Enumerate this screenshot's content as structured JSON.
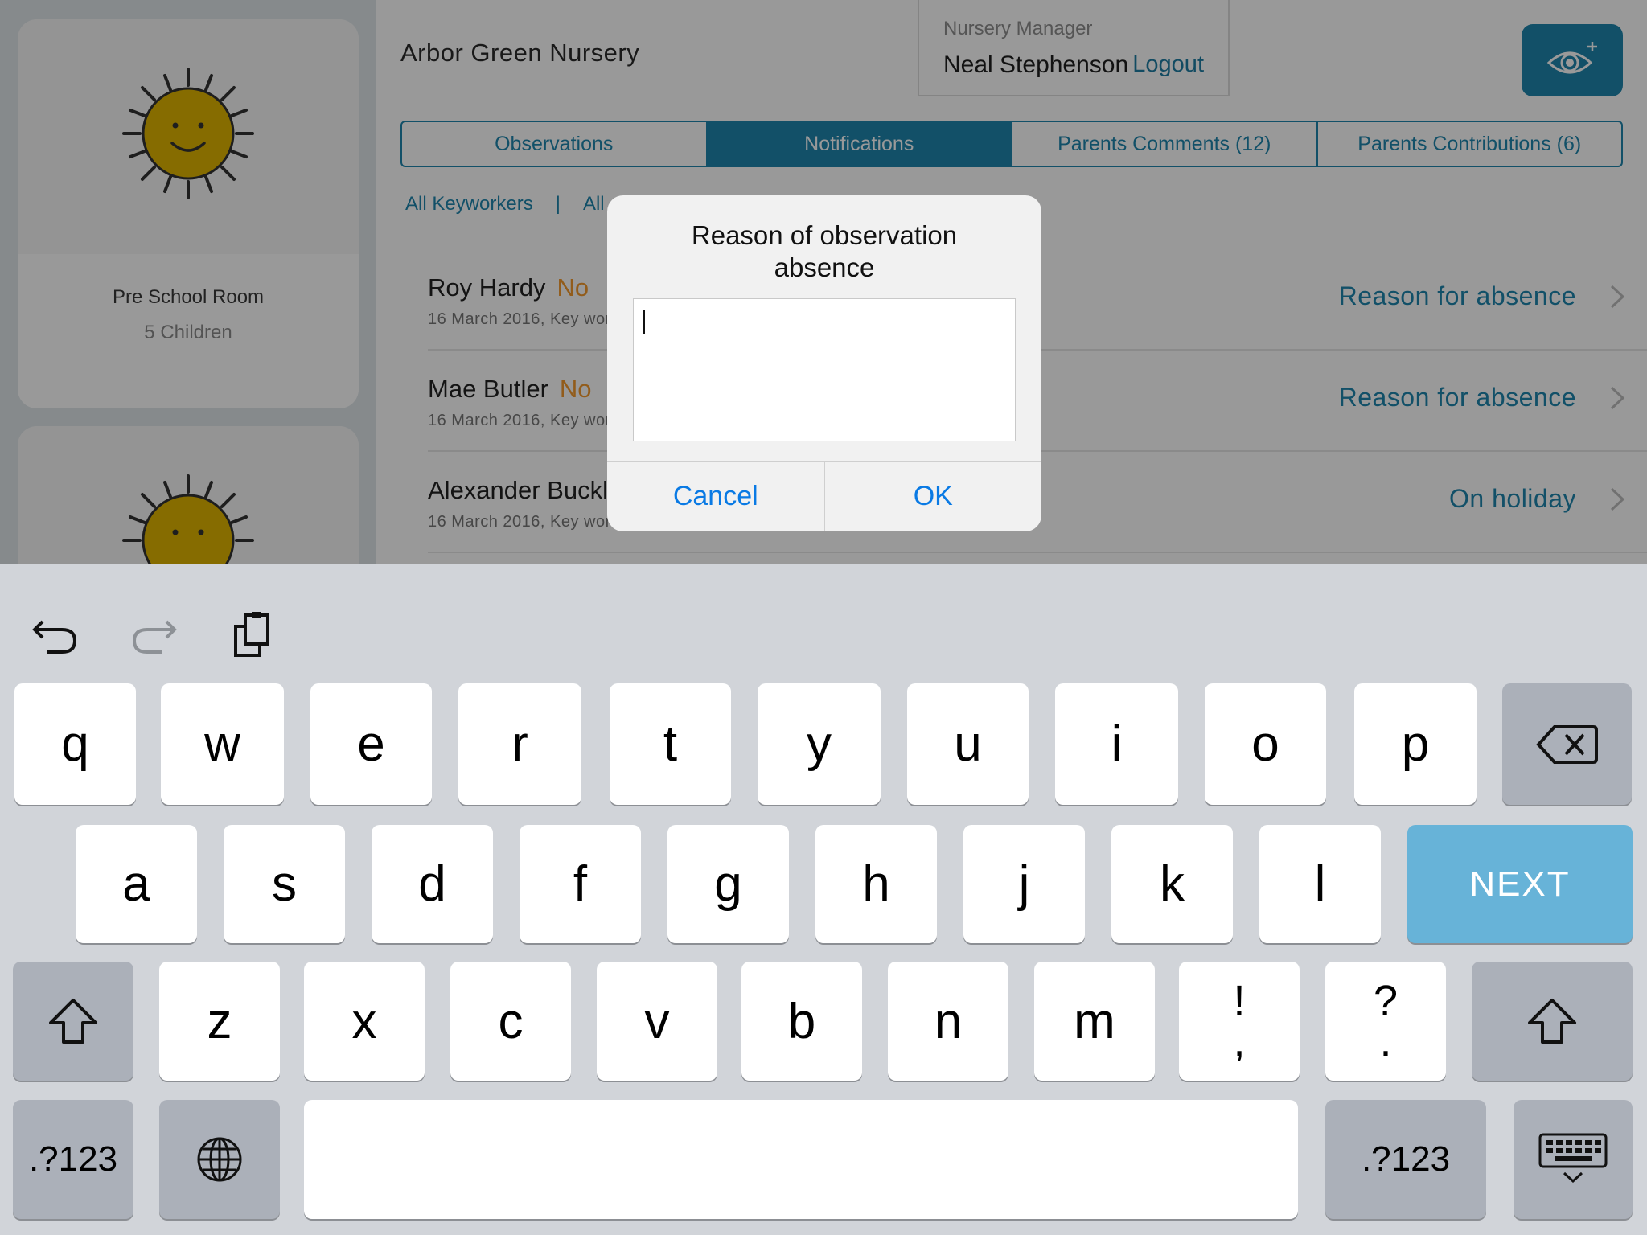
{
  "sidebar": {
    "rooms": [
      {
        "name": "Pre School Room",
        "count": "5 Children"
      }
    ]
  },
  "header": {
    "nursery_name": "Arbor Green Nursery",
    "manager_role": "Nursery Manager",
    "manager_name": "Neal Stephenson",
    "logout_label": "Logout"
  },
  "tabs": [
    {
      "label": "Observations",
      "active": false
    },
    {
      "label": "Notifications",
      "active": true
    },
    {
      "label": "Parents Comments (12)",
      "active": false
    },
    {
      "label": "Parents Contributions (6)",
      "active": false
    }
  ],
  "filters": {
    "keyworkers": "All Keyworkers",
    "separator": "|",
    "second": "All"
  },
  "rows": [
    {
      "name": "Roy Hardy",
      "status": "No",
      "subtitle": "16 March 2016, Key wor",
      "reason": "Reason for absence"
    },
    {
      "name": "Mae Butler",
      "status": "No",
      "subtitle": "16 March 2016, Key wor",
      "reason": "Reason for absence"
    },
    {
      "name": "Alexander Buckl",
      "status": "",
      "subtitle": "16 March 2016, Key wor",
      "reason": "On holiday"
    }
  ],
  "alert": {
    "title": "Reason of observation absence",
    "input_value": "",
    "cancel_label": "Cancel",
    "ok_label": "OK"
  },
  "keyboard": {
    "row1": [
      "q",
      "w",
      "e",
      "r",
      "t",
      "y",
      "u",
      "i",
      "o",
      "p"
    ],
    "row2": [
      "a",
      "s",
      "d",
      "f",
      "g",
      "h",
      "j",
      "k",
      "l"
    ],
    "row3": [
      "z",
      "x",
      "c",
      "v",
      "b",
      "n",
      "m"
    ],
    "punct1_top": "!",
    "punct1_bottom": ",",
    "punct2_top": "?",
    "punct2_bottom": ".",
    "next_label": "NEXT",
    "numbers_label": ".?123",
    "accent_color": "#67b3d8"
  },
  "colors": {
    "brand": "#1e86ad",
    "status_no": "#f39a2d",
    "alert_button": "#0a7ae4"
  }
}
